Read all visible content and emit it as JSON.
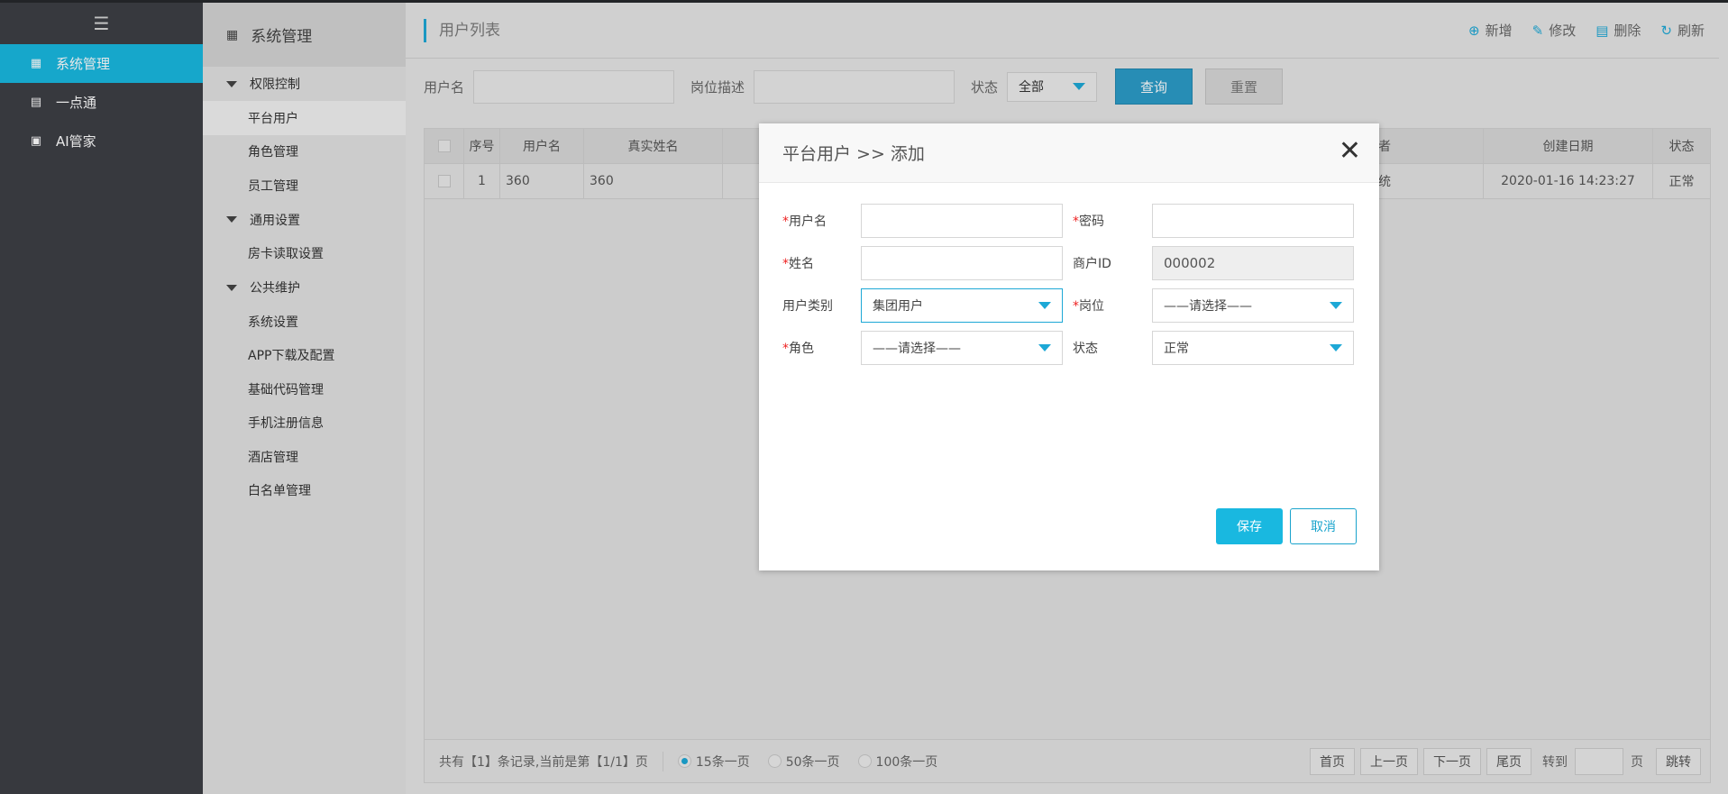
{
  "sidebar": {
    "menu_icon": "hamburger-icon",
    "items": [
      {
        "label": "系统管理",
        "icon": "grid-icon",
        "active": true
      },
      {
        "label": "一点通",
        "icon": "bar-chart-icon",
        "active": false
      },
      {
        "label": "AI管家",
        "icon": "bag-icon",
        "active": false
      }
    ]
  },
  "subnav": {
    "title": "系统管理",
    "groups": [
      {
        "label": "权限控制",
        "links": [
          "平台用户",
          "角色管理",
          "员工管理"
        ]
      },
      {
        "label": "通用设置",
        "links": [
          "房卡读取设置"
        ]
      },
      {
        "label": "公共维护",
        "links": [
          "系统设置",
          "APP下载及配置",
          "基础代码管理",
          "手机注册信息",
          "酒店管理",
          "白名单管理"
        ]
      }
    ],
    "active_link": "平台用户"
  },
  "topbar": {
    "title": "用户列表",
    "actions": [
      {
        "label": "新增",
        "icon": "plus-circle-icon"
      },
      {
        "label": "修改",
        "icon": "pencil-icon"
      },
      {
        "label": "删除",
        "icon": "trash-icon"
      },
      {
        "label": "刷新",
        "icon": "refresh-icon"
      }
    ]
  },
  "search": {
    "username_label": "用户名",
    "position_label": "岗位描述",
    "status_label": "状态",
    "status_value": "全部",
    "query_button": "查询",
    "reset_button": "重置"
  },
  "table": {
    "columns": [
      "序号",
      "用户名",
      "真实姓名",
      "者",
      "创建日期",
      "状态"
    ],
    "rows": [
      {
        "index": "1",
        "username": "360",
        "realname": "360",
        "creator": "统",
        "created": "2020-01-16 14:23:27",
        "status": "正常"
      }
    ]
  },
  "pager": {
    "summary": "共有【1】条记录,当前是第【1/1】页",
    "sizes": [
      {
        "label": "15条一页",
        "selected": true
      },
      {
        "label": "50条一页",
        "selected": false
      },
      {
        "label": "100条一页",
        "selected": false
      }
    ],
    "first": "首页",
    "prev": "上一页",
    "next": "下一页",
    "last": "尾页",
    "goto_label": "转到",
    "page_unit": "页",
    "jump": "跳转"
  },
  "modal": {
    "title": "平台用户 >> 添加",
    "fields": {
      "username_label": "用户名",
      "password_label": "密码",
      "name_label": "姓名",
      "merchant_label": "商户ID",
      "merchant_value": "000002",
      "usertype_label": "用户类别",
      "usertype_value": "集团用户",
      "post_label": "岗位",
      "post_value": "——请选择——",
      "role_label": "角色",
      "role_value": "——请选择——",
      "status_label": "状态",
      "status_value": "正常"
    },
    "save": "保存",
    "cancel": "取消"
  },
  "colors": {
    "accent": "#19b8e0",
    "sidebar_bg": "#3d3f45",
    "required": "#ee2222"
  }
}
